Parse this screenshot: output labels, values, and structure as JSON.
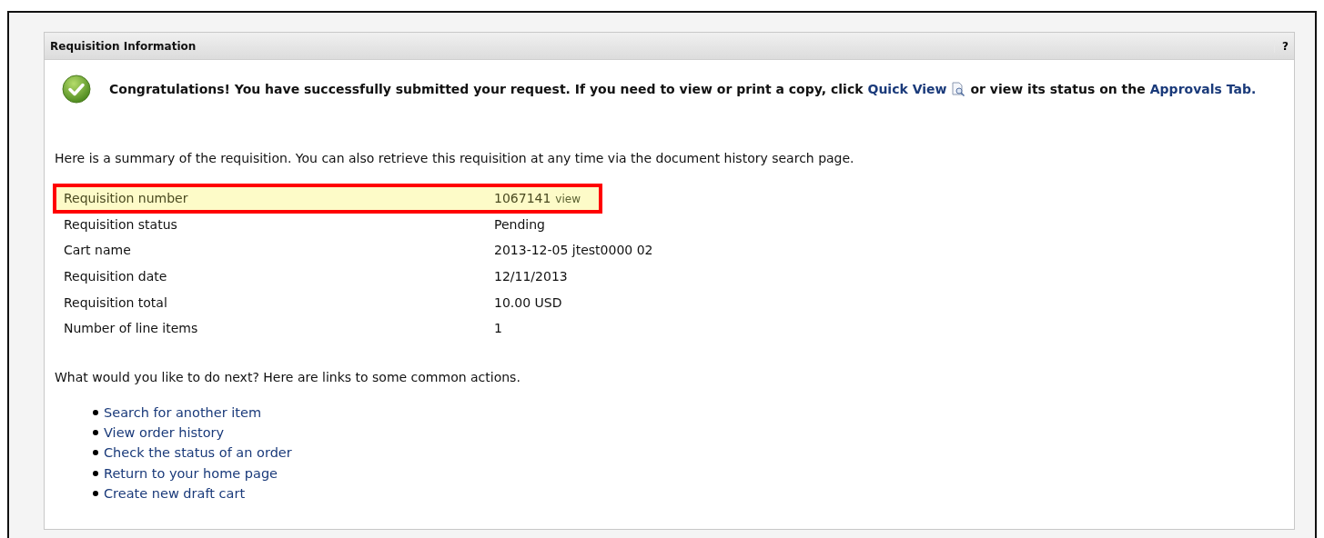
{
  "panel": {
    "title": "Requisition Information",
    "help": "?"
  },
  "message": [
    {
      "kind": "text",
      "text": "Congratulations! You have successfully submitted your request. If you need to view or print a copy, click"
    },
    {
      "kind": "link",
      "text": "Quick View"
    },
    {
      "kind": "icon"
    },
    {
      "kind": "text",
      "text": "or view its status on the"
    },
    {
      "kind": "link",
      "text": "Approvals Tab."
    }
  ],
  "summary": "Here is a summary of the requisition. You can also retrieve this requisition at any time via the document history search page.",
  "rows": [
    {
      "label": "Requisition number",
      "value": "1067141",
      "link": "view",
      "highlighted": true
    },
    {
      "label": "Requisition status",
      "value": "Pending",
      "highlighted": false
    },
    {
      "label": "Cart name",
      "value": "2013-12-05 jtest0000 02",
      "highlighted": false
    },
    {
      "label": "Requisition date",
      "value": "12/11/2013",
      "highlighted": false
    },
    {
      "label": "Requisition total",
      "value": "10.00 USD",
      "highlighted": false
    },
    {
      "label": "Number of line items",
      "value": "1",
      "highlighted": false
    }
  ],
  "next_prompt": "What would you like to do next? Here are links to some common actions.",
  "actions": [
    "Search for another item",
    "View order history",
    "Check the status of an order",
    "Return to your home page",
    "Create new draft cart"
  ]
}
